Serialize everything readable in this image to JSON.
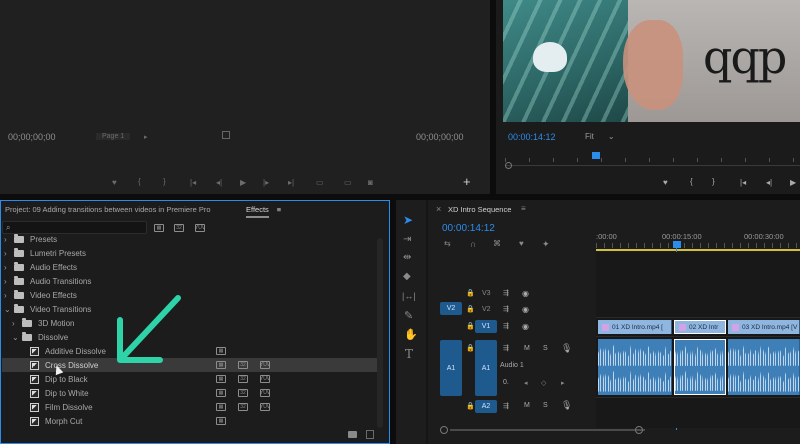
{
  "source_monitor": {
    "timecode_left": "00;00;00;00",
    "page_label": "Page 1",
    "timecode_right": "00;00;00;00",
    "add_button": "+"
  },
  "program_monitor": {
    "timecode": "00:00:14:12",
    "zoom": "Fit",
    "zoom_chevron": "⌄",
    "shirt_text": "qqp"
  },
  "project_panel": {
    "tab_project": "Project: 09 Adding transitions between videos in Premiere Pro",
    "tab_effects": "Effects",
    "menu_icon": "≡",
    "search_placeholder": "",
    "items": [
      {
        "label": "Presets",
        "indent": 0,
        "type": "folder",
        "expander": "›"
      },
      {
        "label": "Lumetri Presets",
        "indent": 0,
        "type": "folder",
        "expander": "›"
      },
      {
        "label": "Audio Effects",
        "indent": 0,
        "type": "folder",
        "expander": "›"
      },
      {
        "label": "Audio Transitions",
        "indent": 0,
        "type": "folder",
        "expander": "›"
      },
      {
        "label": "Video Effects",
        "indent": 0,
        "type": "folder",
        "expander": "›"
      },
      {
        "label": "Video Transitions",
        "indent": 0,
        "type": "folder",
        "expander": "⌄"
      },
      {
        "label": "3D Motion",
        "indent": 1,
        "type": "folder",
        "expander": "›"
      },
      {
        "label": "Dissolve",
        "indent": 1,
        "type": "folder",
        "expander": "⌄"
      },
      {
        "label": "Additive Dissolve",
        "indent": 2,
        "type": "effect",
        "badges": 1
      },
      {
        "label": "Cross Dissolve",
        "indent": 2,
        "type": "effect",
        "badges": 3,
        "selected": true
      },
      {
        "label": "Dip to Black",
        "indent": 2,
        "type": "effect",
        "badges": 3
      },
      {
        "label": "Dip to White",
        "indent": 2,
        "type": "effect",
        "badges": 3
      },
      {
        "label": "Film Dissolve",
        "indent": 2,
        "type": "effect",
        "badges": 3
      },
      {
        "label": "Morph Cut",
        "indent": 2,
        "type": "effect",
        "badges": 1
      }
    ]
  },
  "timeline": {
    "close_icon": "×",
    "sequence_name": "XD Intro Sequence",
    "menu_icon": "≡",
    "timecode": "00:00:14:12",
    "ruler_labels": [
      ":00:00",
      "00:00:15:00",
      "00:00:30:00"
    ],
    "tracks": [
      {
        "name": "V3"
      },
      {
        "name": "V2",
        "source": "V2"
      },
      {
        "name": "V1"
      },
      {
        "name": "A1",
        "source": "A1",
        "sub": "Audio 1",
        "volume": "0."
      },
      {
        "name": "A2"
      }
    ],
    "toggles": {
      "mute": "M",
      "solo": "S"
    },
    "clips": [
      {
        "label": "01 XD Intro.mp4 [",
        "fx": "fx"
      },
      {
        "label": "02 XD Intr",
        "fx": "fx"
      },
      {
        "label": "03 XD Intro.mp4 [V",
        "fx": "fx"
      }
    ]
  },
  "tools": [
    "selection",
    "track-select",
    "ripple-edit",
    "razor",
    "slip",
    "pen",
    "hand",
    "type"
  ],
  "colors": {
    "accent": "#2d8ceb",
    "clip_video": "#8fb6e0",
    "clip_audio": "#3f7fb8",
    "annotation_arrow": "#2fd3a8"
  }
}
